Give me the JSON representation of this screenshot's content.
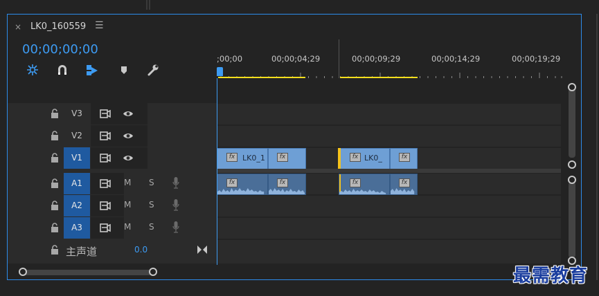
{
  "panel": {
    "sequence_name": "LK0_160559",
    "close_glyph": "×",
    "menu_glyph": "☰",
    "timecode": "00;00;00;00"
  },
  "toolbar": {
    "icons": [
      "insert-nest-icon",
      "snap-magnet-icon",
      "linked-selection-icon",
      "add-marker-icon",
      "settings-wrench-icon"
    ]
  },
  "ruler": {
    "labels": [
      ";00;00",
      "00;00;04;29",
      "00;00;09;29",
      "00;00;14;29",
      "00;00;19;29"
    ]
  },
  "video_tracks": [
    {
      "name": "V3",
      "target": false
    },
    {
      "name": "V2",
      "target": false
    },
    {
      "name": "V1",
      "target": true
    }
  ],
  "audio_tracks": [
    {
      "name": "A1",
      "mute": "M",
      "solo": "S"
    },
    {
      "name": "A2",
      "mute": "M",
      "solo": "S"
    },
    {
      "name": "A3",
      "mute": "M",
      "solo": "S"
    }
  ],
  "master": {
    "label": "主声道",
    "value": "0.0"
  },
  "clips": {
    "video_1_label": "LK0_1",
    "video_3_label": "LK0_",
    "fx": "fx"
  },
  "watermark": "最需教育",
  "colors": {
    "accent": "#2d8ceb",
    "timecode": "#3d9bf2",
    "video_clip": "#6e9fd5",
    "audio_clip": "#4a6e98",
    "work_area": "#f4de1c"
  }
}
